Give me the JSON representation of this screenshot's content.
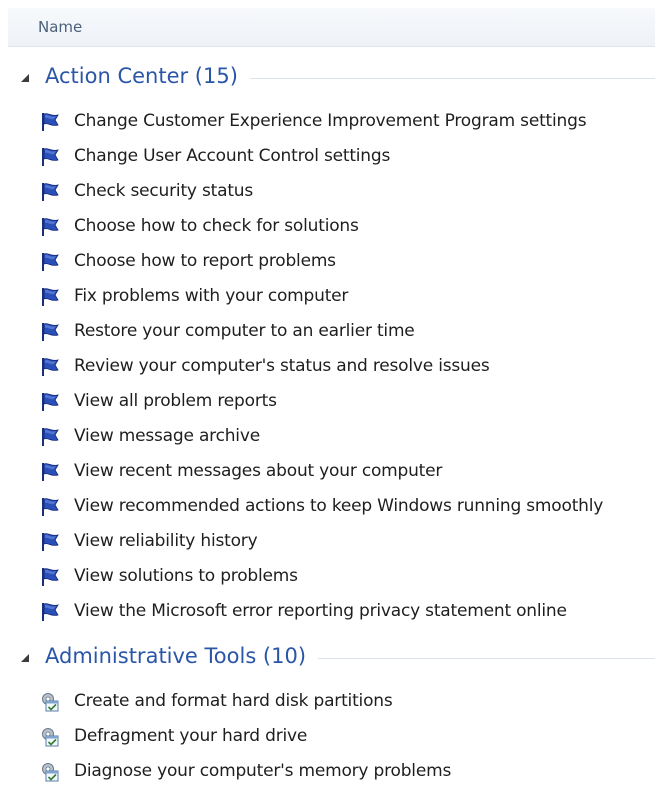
{
  "header": {
    "name_column": "Name"
  },
  "groups": [
    {
      "title": "Action Center (15)",
      "icon": "blue-flag-icon",
      "items": [
        "Change Customer Experience Improvement Program settings",
        "Change User Account Control settings",
        "Check security status",
        "Choose how to check for solutions",
        "Choose how to report problems",
        "Fix problems with your computer",
        "Restore your computer to an earlier time",
        "Review your computer's status and resolve issues",
        "View all problem reports",
        "View message archive",
        "View recent messages about your computer",
        "View recommended actions to keep Windows running smoothly",
        "View reliability history",
        "View solutions to problems",
        "View the Microsoft error reporting privacy statement online"
      ]
    },
    {
      "title": "Administrative Tools (10)",
      "icon": "admin-tools-icon",
      "items": [
        "Create and format hard disk partitions",
        "Defragment your hard drive",
        "Diagnose your computer's memory problems"
      ]
    }
  ]
}
